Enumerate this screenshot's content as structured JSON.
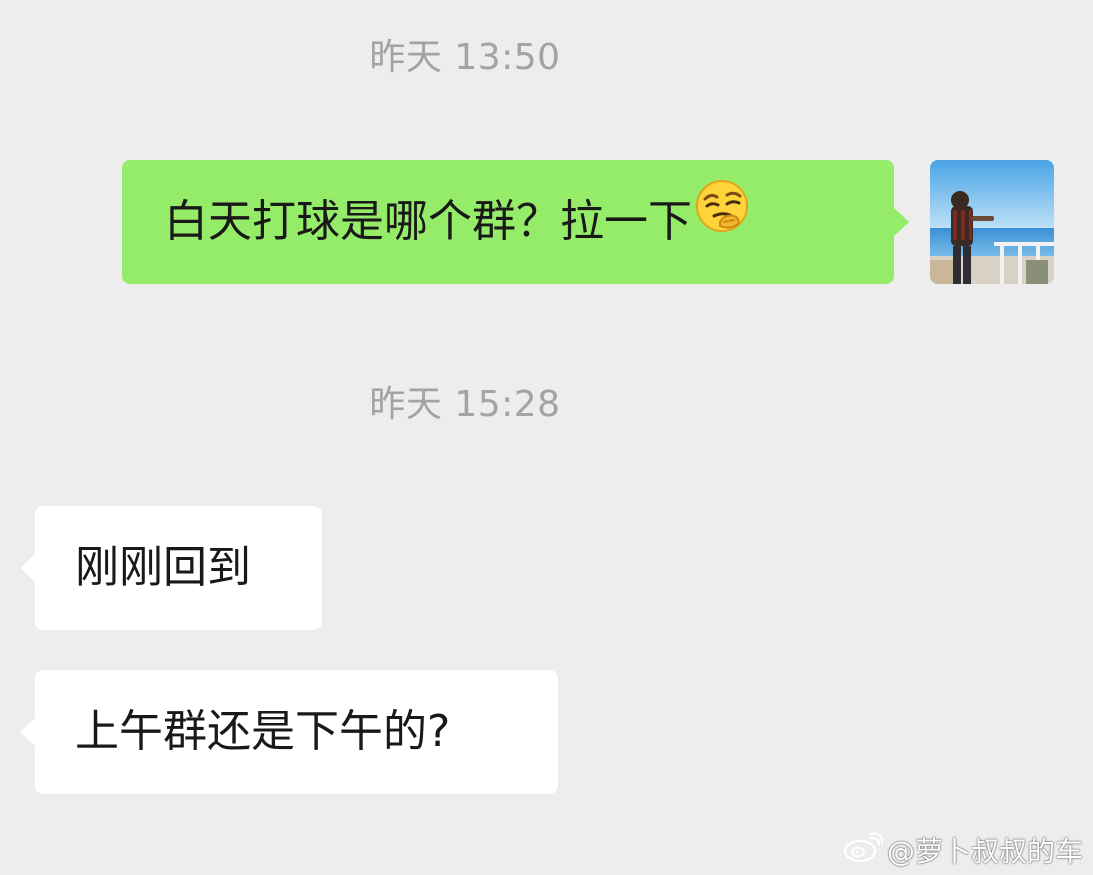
{
  "chat": {
    "messages": [
      {
        "timestamp": "昨天 13:50"
      },
      {
        "direction": "outgoing",
        "text": "白天打球是哪个群？拉一下",
        "emoji": "smirk-emoji"
      },
      {
        "timestamp": "昨天 15:28"
      },
      {
        "direction": "incoming",
        "text": "刚刚回到"
      },
      {
        "direction": "incoming",
        "text": "上午群还是下午的?"
      }
    ]
  },
  "watermark": {
    "logo": "weibo-icon",
    "text": "@萝卜叔叔的车"
  },
  "colors": {
    "background": "#ededed",
    "outgoing_bubble": "#95ec69",
    "incoming_bubble": "#ffffff",
    "timestamp": "#a3a3a3"
  }
}
